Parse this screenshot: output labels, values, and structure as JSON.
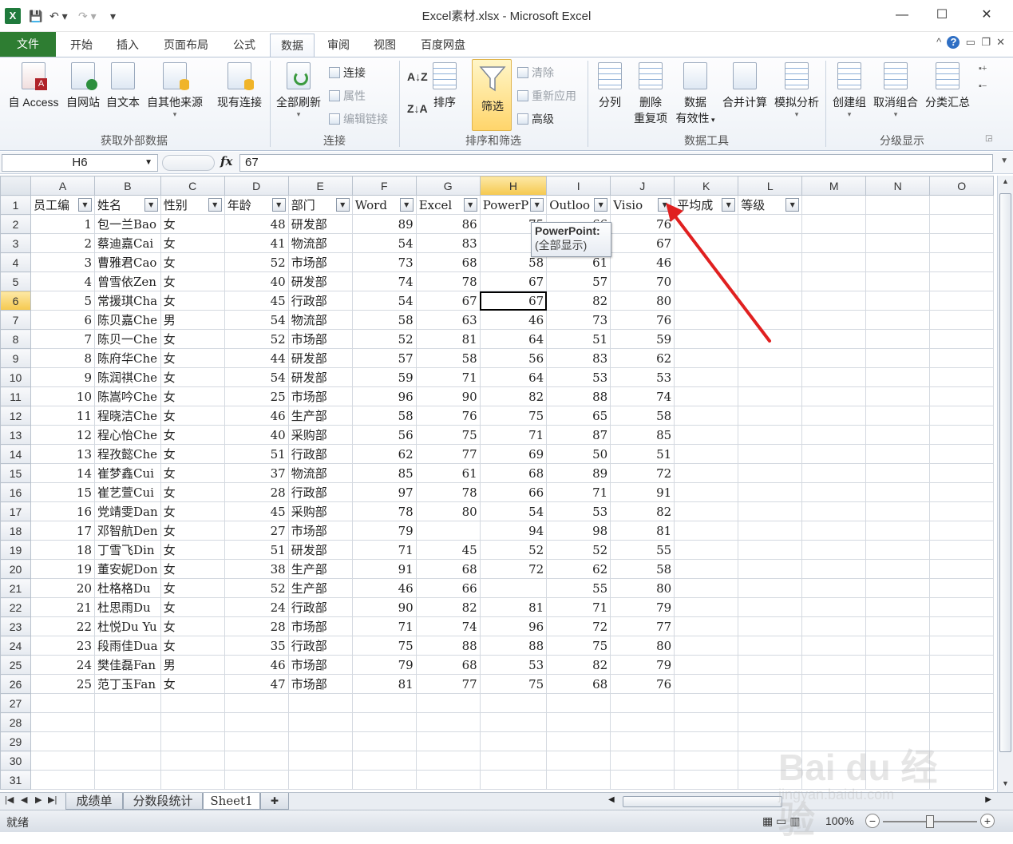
{
  "window": {
    "title": "Excel素材.xlsx  -  Microsoft Excel",
    "app_icon": "X",
    "controls": {
      "minimize": "—",
      "maximize": "☐",
      "close": "✕"
    }
  },
  "ribbon_tabs": [
    "文件",
    "开始",
    "插入",
    "页面布局",
    "公式",
    "数据",
    "审阅",
    "视图",
    "百度网盘"
  ],
  "active_tab": "数据",
  "ribbon": {
    "get_external": {
      "label": "获取外部数据",
      "buttons": [
        "自 Access",
        "自网站",
        "自文本",
        "自其他来源",
        "现有连接"
      ]
    },
    "connections": {
      "label": "连接",
      "refresh_all": "全部刷新",
      "small": [
        "连接",
        "属性",
        "编辑链接"
      ]
    },
    "sort_filter": {
      "label": "排序和筛选",
      "sort": "排序",
      "filter": "筛选",
      "small": [
        "清除",
        "重新应用",
        "高级"
      ]
    },
    "data_tools": {
      "label": "数据工具",
      "buttons": [
        "分列",
        "删除重复项",
        "数据有效性",
        "合并计算",
        "模拟分析"
      ],
      "remove_dup_l1": "删除",
      "remove_dup_l2": "重复项",
      "validation_l1": "数据",
      "validation_l2": "有效性"
    },
    "outline": {
      "label": "分级显示",
      "buttons": [
        "创建组",
        "取消组合",
        "分类汇总"
      ]
    }
  },
  "formula_bar": {
    "name_box": "H6",
    "fx": "fx",
    "value": "67"
  },
  "columns": [
    "A",
    "B",
    "C",
    "D",
    "E",
    "F",
    "G",
    "H",
    "I",
    "J",
    "K",
    "L",
    "M",
    "N",
    "O"
  ],
  "headers": [
    "员工编",
    "姓名",
    "性别",
    "年龄",
    "部门",
    "Word",
    "Excel",
    "PowerP",
    "Outloo",
    "Visio",
    "平均成",
    "等级"
  ],
  "rows": [
    [
      "1",
      "包一兰Bao",
      "女",
      "48",
      "研发部",
      "89",
      "86",
      "75",
      "66",
      "76"
    ],
    [
      "2",
      "蔡迪嘉Cai",
      "女",
      "41",
      "物流部",
      "54",
      "83",
      "5",
      "",
      "67"
    ],
    [
      "3",
      "曹雅君Cao",
      "女",
      "52",
      "市场部",
      "73",
      "68",
      "58",
      "61",
      "46"
    ],
    [
      "4",
      "曾雪依Zen",
      "女",
      "40",
      "研发部",
      "74",
      "78",
      "67",
      "57",
      "70"
    ],
    [
      "5",
      "常援琪Cha",
      "女",
      "45",
      "行政部",
      "54",
      "67",
      "67",
      "82",
      "80"
    ],
    [
      "6",
      "陈贝嘉Che",
      "男",
      "54",
      "物流部",
      "58",
      "63",
      "46",
      "73",
      "76"
    ],
    [
      "7",
      "陈贝一Che",
      "女",
      "52",
      "市场部",
      "52",
      "81",
      "64",
      "51",
      "59"
    ],
    [
      "8",
      "陈府华Che",
      "女",
      "44",
      "研发部",
      "57",
      "58",
      "56",
      "83",
      "62"
    ],
    [
      "9",
      "陈润祺Che",
      "女",
      "54",
      "研发部",
      "59",
      "71",
      "64",
      "53",
      "53"
    ],
    [
      "10",
      "陈嵩吟Che",
      "女",
      "25",
      "市场部",
      "96",
      "90",
      "82",
      "88",
      "74"
    ],
    [
      "11",
      "程晓洁Che",
      "女",
      "46",
      "生产部",
      "58",
      "76",
      "75",
      "65",
      "58"
    ],
    [
      "12",
      "程心怡Che",
      "女",
      "40",
      "采购部",
      "56",
      "75",
      "71",
      "87",
      "85"
    ],
    [
      "13",
      "程孜懿Che",
      "女",
      "51",
      "行政部",
      "62",
      "77",
      "69",
      "50",
      "51"
    ],
    [
      "14",
      "崔梦鑫Cui",
      "女",
      "37",
      "物流部",
      "85",
      "61",
      "68",
      "89",
      "72"
    ],
    [
      "15",
      "崔艺萱Cui",
      "女",
      "28",
      "行政部",
      "97",
      "78",
      "66",
      "71",
      "91"
    ],
    [
      "16",
      "党靖雯Dan",
      "女",
      "45",
      "采购部",
      "78",
      "80",
      "54",
      "53",
      "82"
    ],
    [
      "17",
      "邓智航Den",
      "女",
      "27",
      "市场部",
      "79",
      "",
      "94",
      "98",
      "81"
    ],
    [
      "18",
      "丁雪飞Din",
      "女",
      "51",
      "研发部",
      "71",
      "45",
      "52",
      "52",
      "55"
    ],
    [
      "19",
      "董安妮Don",
      "女",
      "38",
      "生产部",
      "91",
      "68",
      "72",
      "62",
      "58"
    ],
    [
      "20",
      "杜格格Du",
      "女",
      "52",
      "生产部",
      "46",
      "66",
      "",
      "55",
      "80"
    ],
    [
      "21",
      "杜思雨Du",
      "女",
      "24",
      "行政部",
      "90",
      "82",
      "81",
      "71",
      "79"
    ],
    [
      "22",
      "杜悦Du Yu",
      "女",
      "28",
      "市场部",
      "71",
      "74",
      "96",
      "72",
      "77"
    ],
    [
      "23",
      "段雨佳Dua",
      "女",
      "35",
      "行政部",
      "75",
      "88",
      "88",
      "75",
      "80"
    ],
    [
      "24",
      "樊佳磊Fan",
      "男",
      "46",
      "市场部",
      "79",
      "68",
      "53",
      "82",
      "79"
    ],
    [
      "25",
      "范丁玉Fan",
      "女",
      "47",
      "市场部",
      "81",
      "77",
      "75",
      "68",
      "76"
    ]
  ],
  "total_rows": 31,
  "active_cell": "H6",
  "tooltip": {
    "title": "PowerPoint:",
    "text": "(全部显示)"
  },
  "sheet_tabs": [
    "成绩单",
    "分数段统计",
    "Sheet1"
  ],
  "active_sheet": "Sheet1",
  "status": {
    "ready": "就绪",
    "zoom": "100%"
  },
  "watermark": {
    "line1": "Bai du 经验",
    "line2": "jingyan.baidu.com"
  },
  "colors": {
    "file_tab": "#2e7d32",
    "filter_active": "#ffd56b",
    "arrow": "#e02020"
  }
}
